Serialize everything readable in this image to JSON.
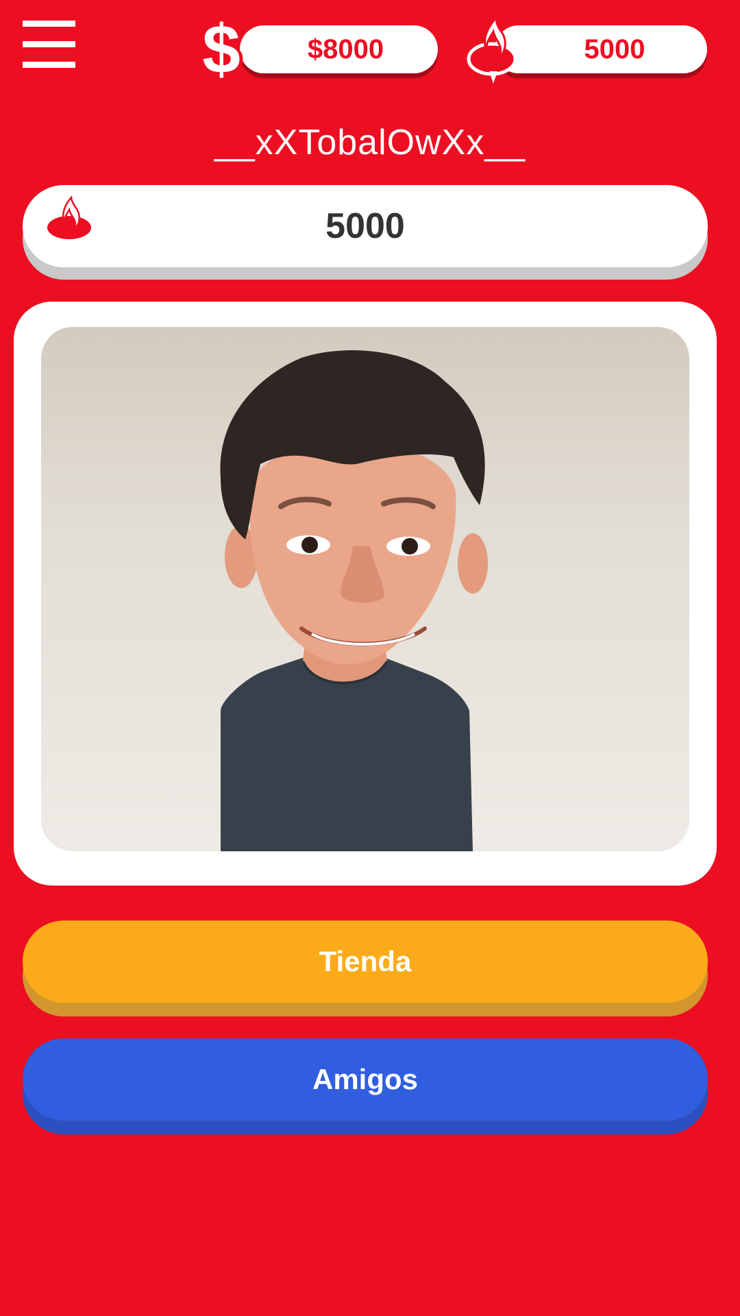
{
  "header": {
    "menu_icon": "hamburger-menu-icon",
    "money": {
      "icon": "dollar-icon",
      "value": "$8000"
    },
    "points": {
      "icon": "santander-flame-icon",
      "value": "5000"
    }
  },
  "profile": {
    "username": "__xXTobalOwXx__",
    "points_bar": {
      "icon": "santander-flame-icon",
      "value": "5000"
    },
    "avatar": "3d-avatar-image"
  },
  "actions": {
    "store_label": "Tienda",
    "friends_label": "Amigos"
  },
  "colors": {
    "background": "#ec0e21",
    "store_button": "#fbab19",
    "friends_button": "#315ede"
  }
}
